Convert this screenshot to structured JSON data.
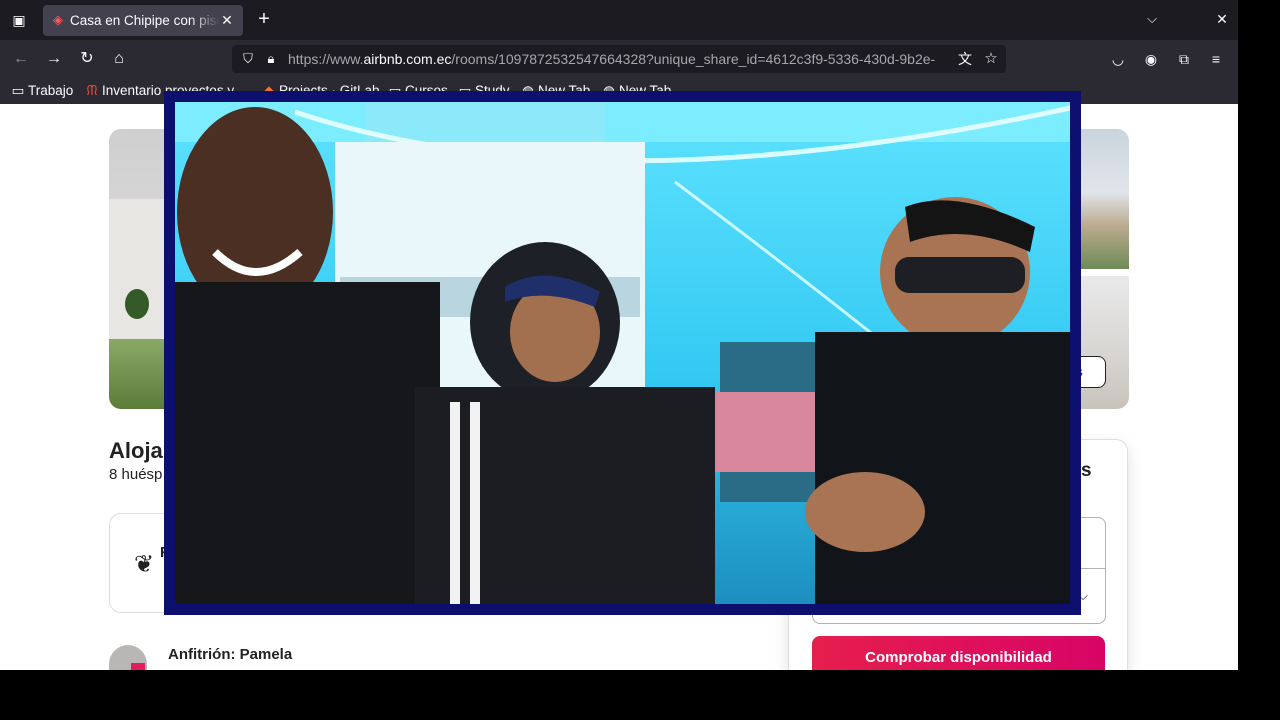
{
  "browser": {
    "tab": {
      "title": "Casa en Chipipe con piscina",
      "favicon": "airbnb-icon"
    },
    "url": {
      "scheme": "https://www.",
      "host": "airbnb.com.ec",
      "path": "/rooms/1097872532547664328?unique_share_id=4612c3f9-5336-430d-9b2e-"
    },
    "bookmarks": [
      {
        "label": "Trabajo",
        "icon": "folder-icon"
      },
      {
        "label": "Inventario proyectos y...",
        "icon": "wave-icon"
      },
      {
        "label": "Projects · GitLab",
        "icon": "gitlab-icon"
      },
      {
        "label": "Cursos",
        "icon": "folder-icon"
      },
      {
        "label": "Study",
        "icon": "folder-icon"
      },
      {
        "label": "New Tab",
        "icon": "globe-icon"
      },
      {
        "label": "New Tab",
        "icon": "globe-icon"
      }
    ]
  },
  "listing": {
    "title_fragment": "Alojam",
    "subtitle_fragment": "8 huésp",
    "feature_fragment": "F",
    "host": "Anfitrión: Pamela",
    "show_photos_fragment": "os",
    "price_fragment": "s",
    "check_button": "Comprobar disponibilidad"
  },
  "video_overlay": {
    "description_colors": {
      "border": "#0c0f6e",
      "room_light": "#33c9f2"
    }
  }
}
